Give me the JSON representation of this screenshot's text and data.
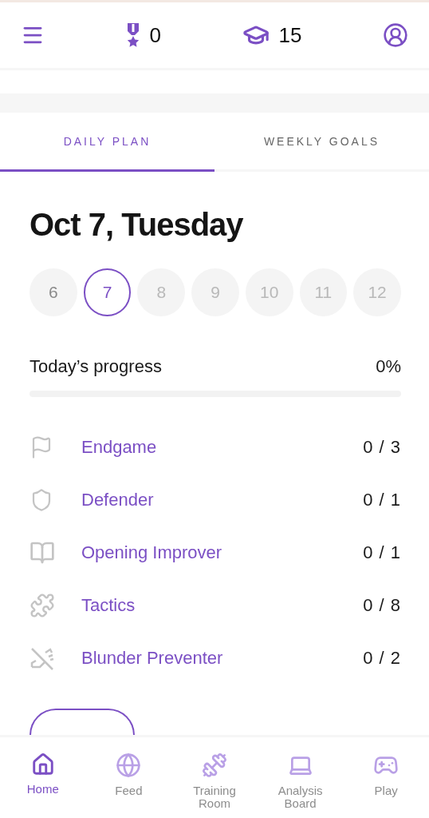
{
  "header": {
    "medals": "0",
    "caps": "15"
  },
  "tabs": [
    {
      "label": "DAILY PLAN",
      "selected": true
    },
    {
      "label": "WEEKLY GOALS",
      "selected": false
    }
  ],
  "date_title": "Oct 7, Tuesday",
  "days": [
    {
      "label": "6",
      "selected": false,
      "disabled": false
    },
    {
      "label": "7",
      "selected": true,
      "disabled": false
    },
    {
      "label": "8",
      "selected": false,
      "disabled": true
    },
    {
      "label": "9",
      "selected": false,
      "disabled": true
    },
    {
      "label": "10",
      "selected": false,
      "disabled": true
    },
    {
      "label": "11",
      "selected": false,
      "disabled": true
    },
    {
      "label": "12",
      "selected": false,
      "disabled": true
    }
  ],
  "progress": {
    "label": "Today’s progress",
    "reading": "0%",
    "level": 0
  },
  "tasks": [
    {
      "name": "Endgame",
      "count": "0 / 3"
    },
    {
      "name": "Defender",
      "count": "0 / 1"
    },
    {
      "name": "Opening Improver",
      "count": "0 / 1"
    },
    {
      "name": "Tactics",
      "count": "0 / 8"
    },
    {
      "name": "Blunder Preventer",
      "count": "0 / 2"
    }
  ],
  "nav": [
    {
      "label": "Home",
      "selected": true
    },
    {
      "label": "Feed",
      "selected": false
    },
    {
      "label": "Training Room",
      "selected": false
    },
    {
      "label": "Analysis Board",
      "selected": false
    },
    {
      "label": "Play",
      "selected": false
    }
  ]
}
